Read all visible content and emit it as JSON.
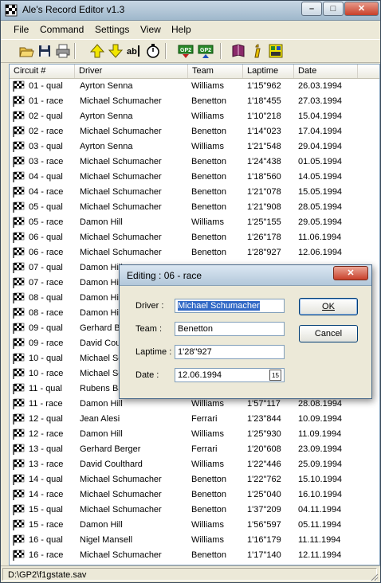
{
  "window": {
    "title": "Ale's Record Editor v1.3",
    "buttons": {
      "minimize": "–",
      "maximize": "□",
      "close": "✕"
    }
  },
  "menu": [
    "File",
    "Command",
    "Settings",
    "View",
    "Help"
  ],
  "columns": [
    "Circuit #",
    "Driver",
    "Team",
    "Laptime",
    "Date"
  ],
  "rows": [
    {
      "circuit": "01 - qual",
      "driver": "Ayrton Senna",
      "team": "Williams",
      "laptime": "1'15\"962",
      "date": "26.03.1994"
    },
    {
      "circuit": "01 - race",
      "driver": "Michael Schumacher",
      "team": "Benetton",
      "laptime": "1'18\"455",
      "date": "27.03.1994"
    },
    {
      "circuit": "02 - qual",
      "driver": "Ayrton Senna",
      "team": "Williams",
      "laptime": "1'10\"218",
      "date": "15.04.1994"
    },
    {
      "circuit": "02 - race",
      "driver": "Michael Schumacher",
      "team": "Benetton",
      "laptime": "1'14\"023",
      "date": "17.04.1994"
    },
    {
      "circuit": "03 - qual",
      "driver": "Ayrton Senna",
      "team": "Williams",
      "laptime": "1'21\"548",
      "date": "29.04.1994"
    },
    {
      "circuit": "03 - race",
      "driver": "Michael Schumacher",
      "team": "Benetton",
      "laptime": "1'24\"438",
      "date": "01.05.1994"
    },
    {
      "circuit": "04 - qual",
      "driver": "Michael Schumacher",
      "team": "Benetton",
      "laptime": "1'18\"560",
      "date": "14.05.1994"
    },
    {
      "circuit": "04 - race",
      "driver": "Michael Schumacher",
      "team": "Benetton",
      "laptime": "1'21\"078",
      "date": "15.05.1994"
    },
    {
      "circuit": "05 - qual",
      "driver": "Michael Schumacher",
      "team": "Benetton",
      "laptime": "1'21\"908",
      "date": "28.05.1994"
    },
    {
      "circuit": "05 - race",
      "driver": "Damon Hill",
      "team": "Williams",
      "laptime": "1'25\"155",
      "date": "29.05.1994"
    },
    {
      "circuit": "06 - qual",
      "driver": "Michael Schumacher",
      "team": "Benetton",
      "laptime": "1'26\"178",
      "date": "11.06.1994"
    },
    {
      "circuit": "06 - race",
      "driver": "Michael Schumacher",
      "team": "Benetton",
      "laptime": "1'28\"927",
      "date": "12.06.1994"
    },
    {
      "circuit": "07 - qual",
      "driver": "Damon Hill",
      "team": "",
      "laptime": "",
      "date": ""
    },
    {
      "circuit": "07 - race",
      "driver": "Damon Hill",
      "team": "",
      "laptime": "",
      "date": ""
    },
    {
      "circuit": "08 - qual",
      "driver": "Damon Hill",
      "team": "",
      "laptime": "",
      "date": ""
    },
    {
      "circuit": "08 - race",
      "driver": "Damon Hill",
      "team": "",
      "laptime": "",
      "date": ""
    },
    {
      "circuit": "09 - qual",
      "driver": "Gerhard Be",
      "team": "",
      "laptime": "",
      "date": ""
    },
    {
      "circuit": "09 - race",
      "driver": "David Coul",
      "team": "",
      "laptime": "",
      "date": ""
    },
    {
      "circuit": "10 - qual",
      "driver": "Michael Sc",
      "team": "",
      "laptime": "",
      "date": ""
    },
    {
      "circuit": "10 - race",
      "driver": "Michael Sc",
      "team": "",
      "laptime": "",
      "date": ""
    },
    {
      "circuit": "11 - qual",
      "driver": "Rubens Ba",
      "team": "",
      "laptime": "",
      "date": ""
    },
    {
      "circuit": "11 - race",
      "driver": "Damon Hill",
      "team": "Williams",
      "laptime": "1'57\"117",
      "date": "28.08.1994"
    },
    {
      "circuit": "12 - qual",
      "driver": "Jean Alesi",
      "team": "Ferrari",
      "laptime": "1'23\"844",
      "date": "10.09.1994"
    },
    {
      "circuit": "12 - race",
      "driver": "Damon Hill",
      "team": "Williams",
      "laptime": "1'25\"930",
      "date": "11.09.1994"
    },
    {
      "circuit": "13 - qual",
      "driver": "Gerhard Berger",
      "team": "Ferrari",
      "laptime": "1'20\"608",
      "date": "23.09.1994"
    },
    {
      "circuit": "13 - race",
      "driver": "David Coulthard",
      "team": "Williams",
      "laptime": "1'22\"446",
      "date": "25.09.1994"
    },
    {
      "circuit": "14 - qual",
      "driver": "Michael Schumacher",
      "team": "Benetton",
      "laptime": "1'22\"762",
      "date": "15.10.1994"
    },
    {
      "circuit": "14 - race",
      "driver": "Michael Schumacher",
      "team": "Benetton",
      "laptime": "1'25\"040",
      "date": "16.10.1994"
    },
    {
      "circuit": "15 - qual",
      "driver": "Michael Schumacher",
      "team": "Benetton",
      "laptime": "1'37\"209",
      "date": "04.11.1994"
    },
    {
      "circuit": "15 - race",
      "driver": "Damon Hill",
      "team": "Williams",
      "laptime": "1'56\"597",
      "date": "05.11.1994"
    },
    {
      "circuit": "16 - qual",
      "driver": "Nigel Mansell",
      "team": "Williams",
      "laptime": "1'16\"179",
      "date": "11.11.1994"
    },
    {
      "circuit": "16 - race",
      "driver": "Michael Schumacher",
      "team": "Benetton",
      "laptime": "1'17\"140",
      "date": "12.11.1994"
    }
  ],
  "status": "D:\\GP2\\f1gstate.sav",
  "dialog": {
    "title": "Editing : 06 - race",
    "close": "✕",
    "driver_label": "Driver :",
    "driver_value": "Michael Schumacher",
    "team_label": "Team :",
    "team_value": "Benetton",
    "laptime_label": "Laptime :",
    "laptime_value": "1'28\"927",
    "date_label": "Date :",
    "date_value": "12.06.1994",
    "calendar_glyph": "15",
    "ok": "OK",
    "cancel": "Cancel"
  },
  "toolbar_icons": [
    "open-folder-icon",
    "save-icon",
    "print-icon",
    "edit-text-icon",
    "stopwatch-icon",
    "arrow-up-icon",
    "arrow-down-icon",
    "import-gp2-icon",
    "export-gp2-icon",
    "book-icon",
    "info-icon",
    "about-icon"
  ],
  "colors": {
    "selection": "#3169c6",
    "window_bg": "#ece9d8",
    "title_gradient_top": "#c7d6e4"
  }
}
